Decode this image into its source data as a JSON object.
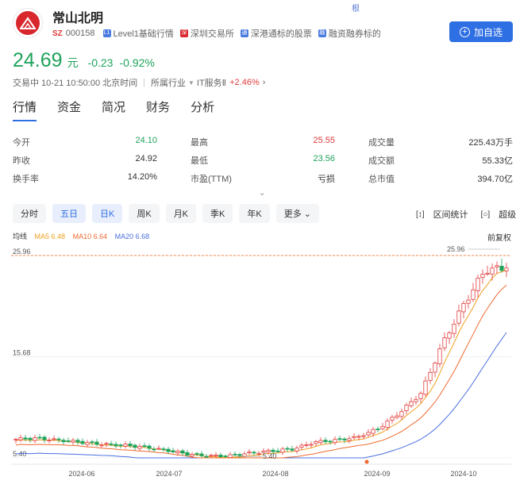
{
  "stock": {
    "name": "常山北明",
    "market": "SZ",
    "code": "000158",
    "tags": [
      "Level1基础行情",
      "深圳交易所",
      "深港通标的股票",
      "融资融券标的"
    ],
    "small_mark": "根",
    "add_button": "加自选"
  },
  "quote": {
    "price": "24.69",
    "unit": "元",
    "change": "-0.23",
    "change_pct": "-0.92%",
    "status": "交易中 10-21 10:50:00 北京时间",
    "industry_label": "所属行业",
    "industry": "IT服务Ⅱ",
    "industry_change": "+2.46%"
  },
  "tabs": [
    "行情",
    "资金",
    "简况",
    "财务",
    "分析"
  ],
  "stats": [
    [
      {
        "label": "今开",
        "value": "24.10",
        "color": "green"
      },
      {
        "label": "最高",
        "value": "25.55",
        "color": "red"
      },
      {
        "label": "成交量",
        "value": "225.43万手",
        "color": ""
      }
    ],
    [
      {
        "label": "昨收",
        "value": "24.92",
        "color": ""
      },
      {
        "label": "最低",
        "value": "23.56",
        "color": "green"
      },
      {
        "label": "成交额",
        "value": "55.33亿",
        "color": ""
      }
    ],
    [
      {
        "label": "换手率",
        "value": "14.20%",
        "color": ""
      },
      {
        "label": "市盈(TTM)",
        "value": "亏损",
        "color": ""
      },
      {
        "label": "总市值",
        "value": "394.70亿",
        "color": ""
      }
    ]
  ],
  "periods": [
    "分时",
    "五日",
    "日K",
    "周K",
    "月K",
    "季K",
    "年K",
    "更多"
  ],
  "tools": {
    "range_stats": "区间统计",
    "super_view": "超级视图"
  },
  "ma": {
    "label": "均线",
    "ma5": "MA5 6.48",
    "ma10": "MA10 6.64",
    "ma20": "MA20 6.68",
    "adjust": "前复权"
  },
  "colors": {
    "up": "#e23b3b",
    "down": "#1fa35c",
    "accent": "#2f6fe4",
    "ma5": "#f0a020",
    "ma10": "#f06a30",
    "ma20": "#4a6fe0"
  },
  "chart_data": {
    "type": "candlestick",
    "y_ticks": [
      "25.96",
      "15.68",
      "5.40"
    ],
    "x_ticks": [
      "2024-06",
      "2024-07",
      "2024-08",
      "2024-09",
      "2024-10"
    ],
    "max_label": "25.96",
    "min_label": "5.40",
    "ylim": [
      5.4,
      25.96
    ],
    "close_trend": [
      7.3,
      7.4,
      7.2,
      7.0,
      6.8,
      6.7,
      6.5,
      6.2,
      5.8,
      5.6,
      5.6,
      5.9,
      6.1,
      6.3,
      7.0,
      7.2,
      7.5,
      8.4,
      10.0,
      12.0,
      17.0,
      21.0,
      24.5,
      24.69
    ]
  }
}
